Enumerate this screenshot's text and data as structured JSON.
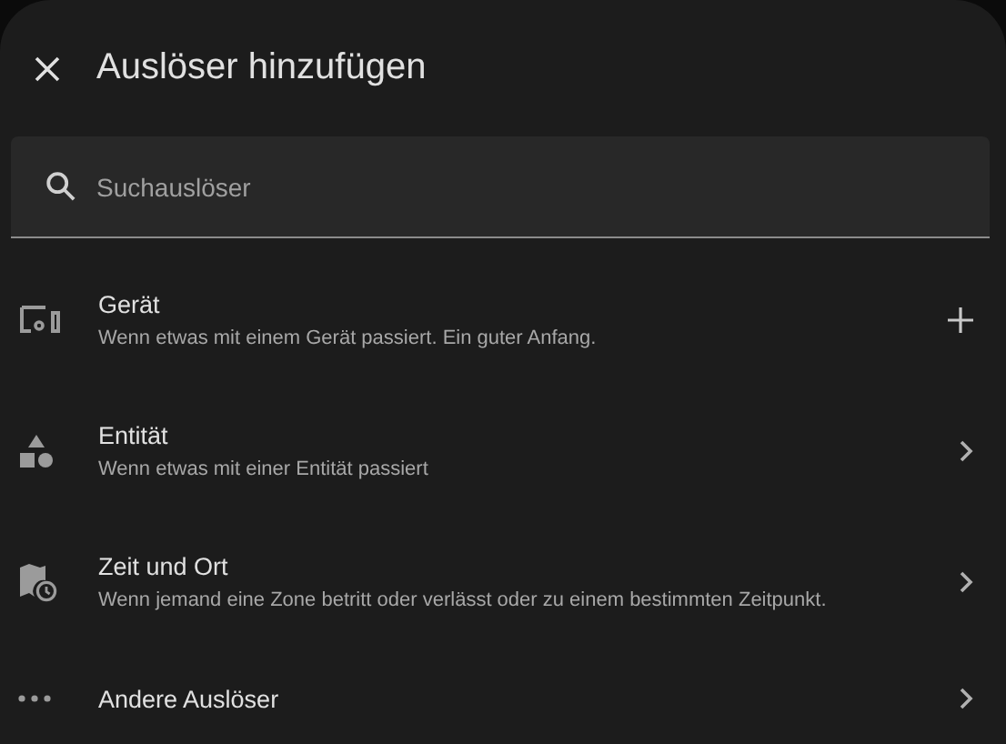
{
  "dialog": {
    "title": "Auslöser hinzufügen"
  },
  "search": {
    "placeholder": "Suchauslöser"
  },
  "items": [
    {
      "kind": "device",
      "title": "Gerät",
      "subtitle": "Wenn etwas mit einem Gerät passiert. Ein guter Anfang.",
      "expands": false
    },
    {
      "kind": "entity",
      "title": "Entität",
      "subtitle": "Wenn etwas mit einer Entität passiert",
      "expands": true
    },
    {
      "kind": "time_location",
      "title": "Zeit und Ort",
      "subtitle": "Wenn jemand eine Zone betritt oder verlässt oder zu einem bestimmten Zeitpunkt.",
      "expands": true
    },
    {
      "kind": "other",
      "title": "Andere Auslöser",
      "expands": true
    }
  ]
}
